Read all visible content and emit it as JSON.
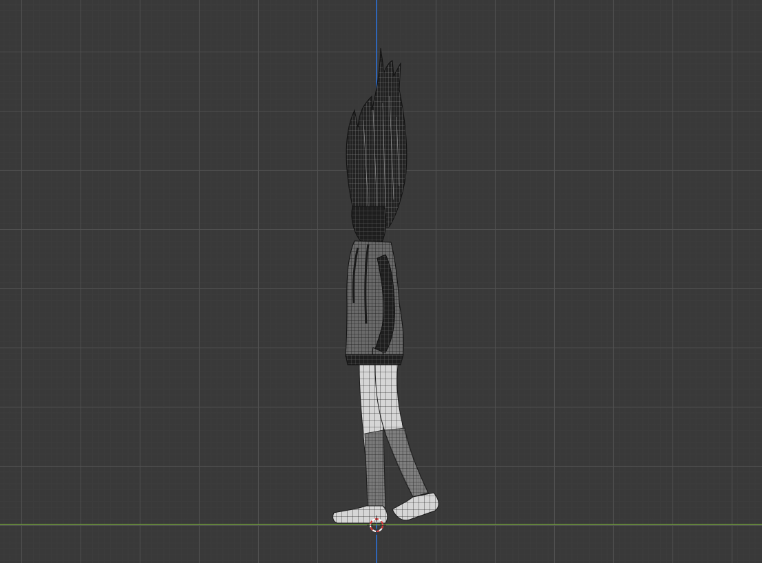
{
  "viewport": {
    "view": "orthographic-side",
    "shading": "wireframe",
    "grid": true,
    "colors": {
      "background": "#393939",
      "grid_major": "#525252",
      "grid_minor": "#3c3c3c",
      "axis_z": "#2a6fd6",
      "axis_y": "#6e9a3b",
      "mesh_dark": "#1a1a1a",
      "mesh_light": "#d9d9d9",
      "cursor_red": "#d82c2c"
    }
  },
  "scene": {
    "object_icon": "wireframe-character-mesh",
    "cursor_icon": "3d-cursor-icon"
  }
}
